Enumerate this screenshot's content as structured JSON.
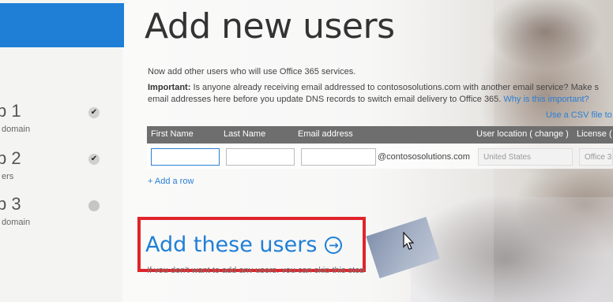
{
  "page": {
    "title": "Add new users"
  },
  "sidebar": {
    "steps": [
      {
        "number": "p 1",
        "sub": "domain",
        "state": "done"
      },
      {
        "number": "p 2",
        "sub": "ers",
        "state": "done"
      },
      {
        "number": "p 3",
        "sub": "domain",
        "state": "pending"
      }
    ]
  },
  "content": {
    "intro": "Now add other users who will use Office 365 services.",
    "important_label": "Important:",
    "important_text": " Is anyone already receiving email addressed to contososolutions.com with another email service? Make s",
    "important_line2": "email addresses here before you update DNS records to switch email delivery to Office 365. ",
    "why_link": "Why is this important?",
    "csv_link": "Use a CSV file to"
  },
  "table": {
    "headers": {
      "first_name": "First Name",
      "last_name": "Last Name",
      "email": "Email address",
      "location_prefix": "User location (",
      "location_change": "change",
      "location_suffix": ")",
      "license": "License ("
    },
    "row": {
      "domain": "@contososolutions.com",
      "location_value": "United States",
      "license_value": "Office 3"
    },
    "add_row": "+ Add a row"
  },
  "actions": {
    "add_users": "Add these users",
    "skip_text": "If you don't want to add any users, you can skip this step"
  },
  "colors": {
    "accent": "#1f7fd6",
    "highlight": "#e0242b",
    "header_bg": "#6e6e6e"
  }
}
